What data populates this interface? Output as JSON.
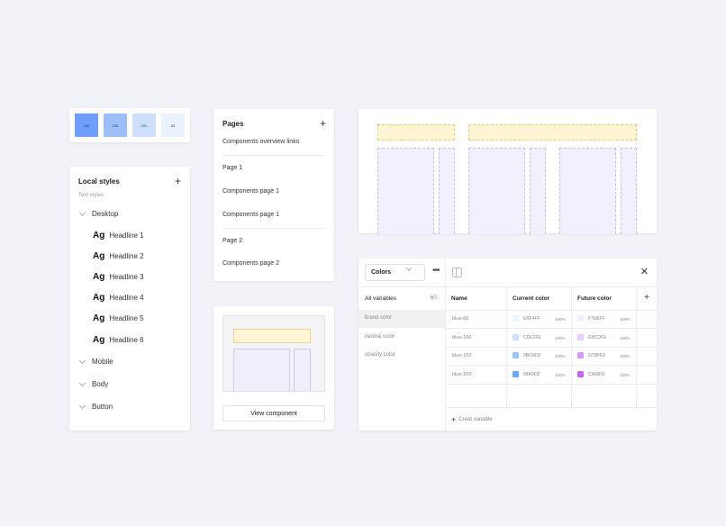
{
  "swatches": [
    {
      "label": "200",
      "color": "#6e9dfb"
    },
    {
      "label": "150",
      "color": "#9cbff9"
    },
    {
      "label": "100",
      "color": "#cddffc"
    },
    {
      "label": "50",
      "color": "#e9f2fe"
    }
  ],
  "local_styles": {
    "title": "Local styles",
    "plus": "+",
    "subtitle": "Text styles",
    "groups": {
      "desktop": "Desktop",
      "mobile": "Mobile",
      "body": "Body",
      "button": "Button"
    },
    "ag": "Ag",
    "items": [
      "Headline 1",
      "Headline 2",
      "Headline 3",
      "Headline 4",
      "Headline 5",
      "Headline 6"
    ]
  },
  "pages": {
    "title": "Pages",
    "plus": "+",
    "items": [
      "Components overview links",
      "Page 1",
      "Components page 1",
      "Components page 1",
      "Page 2",
      "Components page 2"
    ]
  },
  "component": {
    "button_label": "View component"
  },
  "variables": {
    "collection": "Colors",
    "sidebar": {
      "all_label": "All variables",
      "all_count": "60",
      "groups": [
        "brand color",
        "neutral color",
        "opacity color"
      ]
    },
    "columns": {
      "name": "Name",
      "current": "Current color",
      "future": "Future color"
    },
    "rows": [
      {
        "name": "blue-50",
        "current_hex": "EBF4FF",
        "current_pct": "100%",
        "current_color": "#ebf4ff",
        "future_hex": "F7EBFF",
        "future_pct": "100%",
        "future_color": "#f7ebff"
      },
      {
        "name": "blue-100",
        "current_hex": "CDE2FE",
        "current_pct": "100%",
        "current_color": "#cde2fe",
        "future_hex": "EBCDFE",
        "future_pct": "100%",
        "future_color": "#ebcdfe"
      },
      {
        "name": "blue-150",
        "current_hex": "9BC6FD",
        "current_pct": "100%",
        "current_color": "#9bc6fd",
        "future_hex": "D79BFD",
        "future_pct": "100%",
        "future_color": "#d79bfd"
      },
      {
        "name": "blue-200",
        "current_hex": "68A9FD",
        "current_pct": "100%",
        "current_color": "#68a9fd",
        "future_hex": "C468FD",
        "future_pct": "100%",
        "future_color": "#c468fd"
      }
    ],
    "add": "+",
    "create_label": "Creat variable",
    "close": "✕"
  }
}
